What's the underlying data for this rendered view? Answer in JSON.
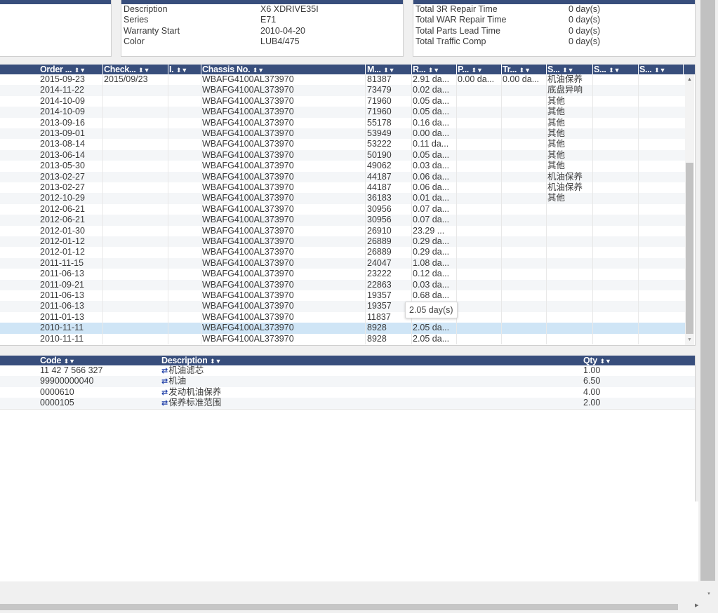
{
  "vehicle_info": [
    {
      "label": "Description",
      "value": "X6 XDRIVE35I"
    },
    {
      "label": "Series",
      "value": "E71"
    },
    {
      "label": "Warranty Start",
      "value": "2010-04-20"
    },
    {
      "label": "Color",
      "value": "LUB4/475"
    }
  ],
  "totals": [
    {
      "label": "Total 3R Repair Time",
      "value": "0 day(s)"
    },
    {
      "label": "Total WAR Repair Time",
      "value": "0 day(s)"
    },
    {
      "label": "Total Parts Lead Time",
      "value": "0 day(s)"
    },
    {
      "label": "Total Traffic Comp",
      "value": "0 day(s)"
    }
  ],
  "orders": {
    "columns": [
      "Order ...",
      "Check...",
      "I.",
      "Chassis No.",
      "M...",
      "R...",
      "P...",
      "Tr...",
      "S...",
      "S...",
      "S..."
    ],
    "rows": [
      [
        "2015-09-23",
        "2015/09/23",
        "",
        "WBAFG4100AL373970",
        "81387",
        "2.91 da...",
        "0.00 da...",
        "0.00 da...",
        "机油保养"
      ],
      [
        "2014-11-22",
        "",
        "",
        "WBAFG4100AL373970",
        "73479",
        "0.02 da...",
        "",
        "",
        "底盘异响"
      ],
      [
        "2014-10-09",
        "",
        "",
        "WBAFG4100AL373970",
        "71960",
        "0.05 da...",
        "",
        "",
        "其他"
      ],
      [
        "2014-10-09",
        "",
        "",
        "WBAFG4100AL373970",
        "71960",
        "0.05 da...",
        "",
        "",
        "其他"
      ],
      [
        "2013-09-16",
        "",
        "",
        "WBAFG4100AL373970",
        "55178",
        "0.16 da...",
        "",
        "",
        "其他"
      ],
      [
        "2013-09-01",
        "",
        "",
        "WBAFG4100AL373970",
        "53949",
        "0.00 da...",
        "",
        "",
        "其他"
      ],
      [
        "2013-08-14",
        "",
        "",
        "WBAFG4100AL373970",
        "53222",
        "0.11 da...",
        "",
        "",
        "其他"
      ],
      [
        "2013-06-14",
        "",
        "",
        "WBAFG4100AL373970",
        "50190",
        "0.05 da...",
        "",
        "",
        "其他"
      ],
      [
        "2013-05-30",
        "",
        "",
        "WBAFG4100AL373970",
        "49062",
        "0.03 da...",
        "",
        "",
        "其他"
      ],
      [
        "2013-02-27",
        "",
        "",
        "WBAFG4100AL373970",
        "44187",
        "0.06 da...",
        "",
        "",
        "机油保养"
      ],
      [
        "2013-02-27",
        "",
        "",
        "WBAFG4100AL373970",
        "44187",
        "0.06 da...",
        "",
        "",
        "机油保养"
      ],
      [
        "2012-10-29",
        "",
        "",
        "WBAFG4100AL373970",
        "36183",
        "0.01 da...",
        "",
        "",
        "其他"
      ],
      [
        "2012-06-21",
        "",
        "",
        "WBAFG4100AL373970",
        "30956",
        "0.07 da...",
        "",
        "",
        ""
      ],
      [
        "2012-06-21",
        "",
        "",
        "WBAFG4100AL373970",
        "30956",
        "0.07 da...",
        "",
        "",
        ""
      ],
      [
        "2012-01-30",
        "",
        "",
        "WBAFG4100AL373970",
        "26910",
        "23.29 ...",
        "",
        "",
        ""
      ],
      [
        "2012-01-12",
        "",
        "",
        "WBAFG4100AL373970",
        "26889",
        "0.29 da...",
        "",
        "",
        ""
      ],
      [
        "2012-01-12",
        "",
        "",
        "WBAFG4100AL373970",
        "26889",
        "0.29 da...",
        "",
        "",
        ""
      ],
      [
        "2011-11-15",
        "",
        "",
        "WBAFG4100AL373970",
        "24047",
        "1.08 da...",
        "",
        "",
        ""
      ],
      [
        "2011-06-13",
        "",
        "",
        "WBAFG4100AL373970",
        "23222",
        "0.12 da...",
        "",
        "",
        ""
      ],
      [
        "2011-09-21",
        "",
        "",
        "WBAFG4100AL373970",
        "22863",
        "0.03 da...",
        "",
        "",
        ""
      ],
      [
        "2011-06-13",
        "",
        "",
        "WBAFG4100AL373970",
        "19357",
        "0.68 da...",
        "",
        "",
        ""
      ],
      [
        "2011-06-13",
        "",
        "",
        "WBAFG4100AL373970",
        "19357",
        "",
        "",
        "",
        ""
      ],
      [
        "2011-01-13",
        "",
        "",
        "WBAFG4100AL373970",
        "11837",
        "",
        "",
        "",
        ""
      ],
      [
        "2010-11-11",
        "",
        "",
        "WBAFG4100AL373970",
        "8928",
        "2.05 da...",
        "",
        "",
        ""
      ],
      [
        "2010-11-11",
        "",
        "",
        "WBAFG4100AL373970",
        "8928",
        "2.05 da...",
        "",
        "",
        ""
      ]
    ],
    "selected_row": 23,
    "tooltip": "2.05 day(s)"
  },
  "parts": {
    "columns": [
      "Code",
      "Description",
      "Qty"
    ],
    "rows": [
      [
        "11 42 7 566 327",
        "机油滤芯",
        "1.00"
      ],
      [
        "99900000040",
        "机油",
        "6.50"
      ],
      [
        "0000610",
        "发动机油保养",
        "4.00"
      ],
      [
        "0000105",
        "保养标准范围",
        "2.00"
      ]
    ]
  },
  "icons": {
    "sort": "sort-updown-icon",
    "filter": "filter-funnel-icon",
    "link": "swap-arrows-icon"
  },
  "colors": {
    "header": "#384e7c",
    "selected": "#cfe5f6"
  }
}
